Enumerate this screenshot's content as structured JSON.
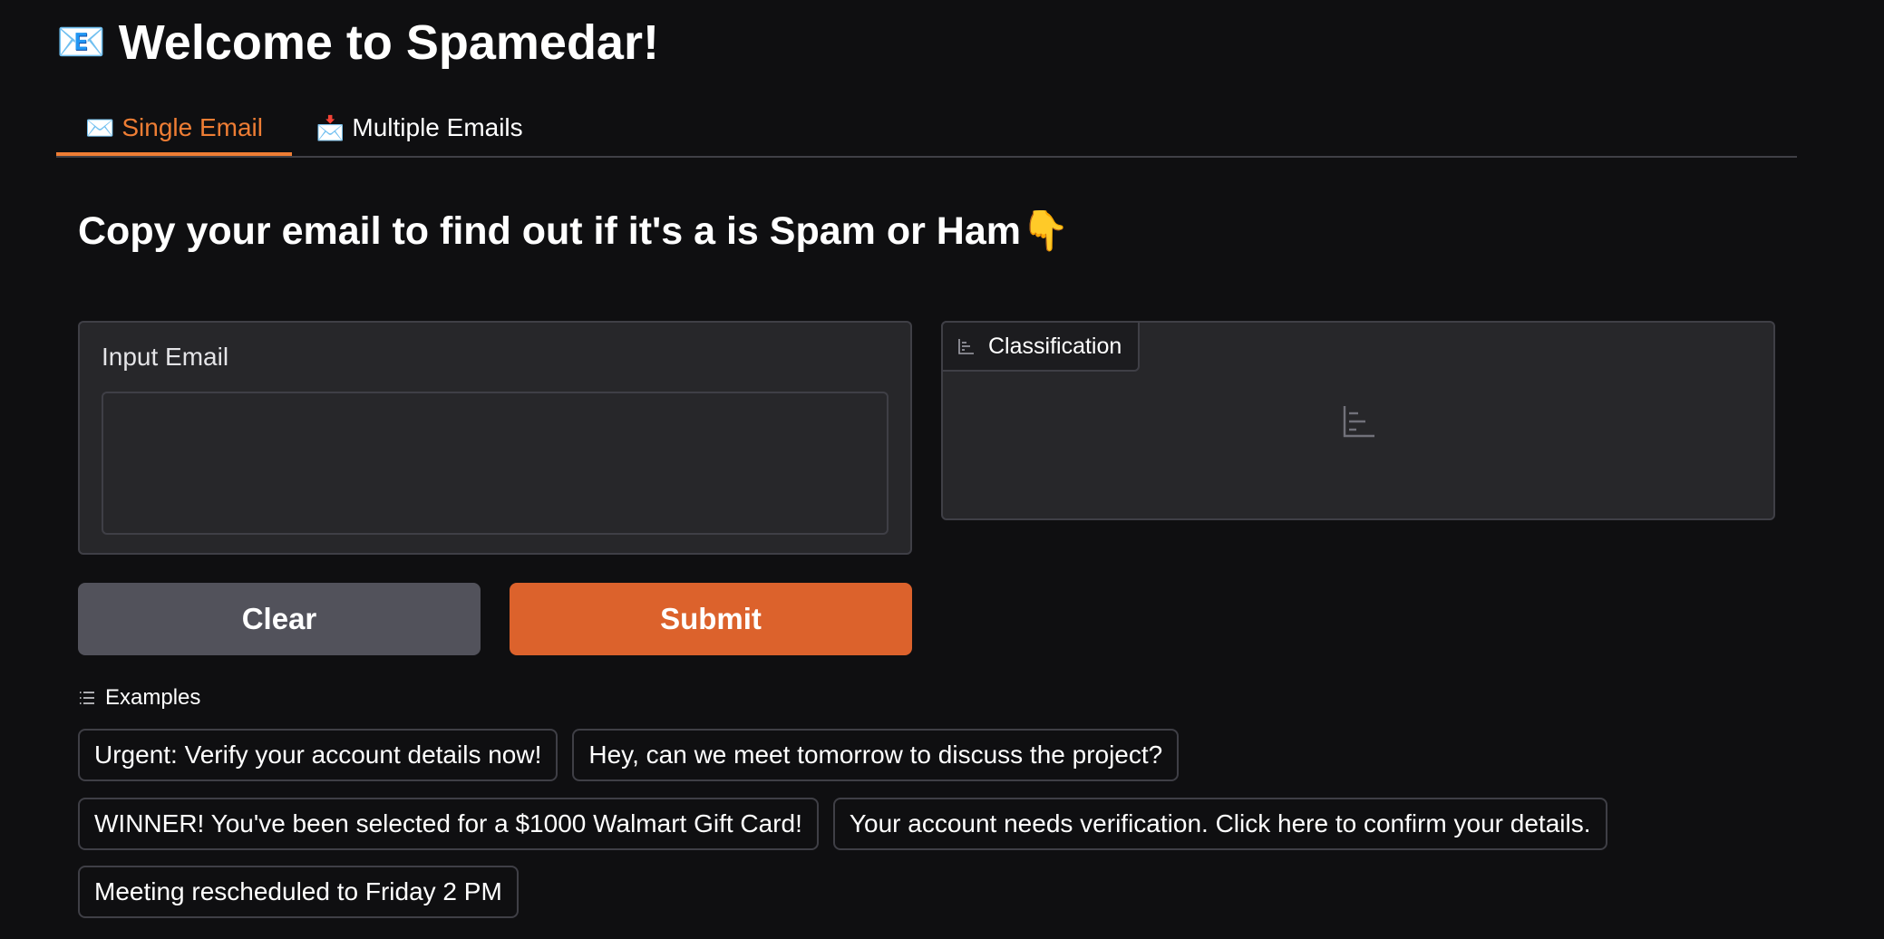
{
  "header": {
    "icon": "📧",
    "icon_name": "envelope-icon",
    "title": "Welcome to Spamedar!"
  },
  "tabs": [
    {
      "icon": "✉️",
      "label": "Single Email",
      "active": true
    },
    {
      "icon": "📩",
      "label": "Multiple Emails",
      "active": false
    }
  ],
  "main": {
    "heading": "Copy your email to find out if it's a is Spam or Ham",
    "heading_emoji": "👇",
    "input": {
      "label": "Input Email",
      "value": "",
      "placeholder": ""
    },
    "output": {
      "label": "Classification",
      "icon_name": "bar-chart-icon"
    },
    "buttons": {
      "clear": "Clear",
      "submit": "Submit"
    },
    "examples": {
      "label": "Examples",
      "icon_name": "list-icon",
      "items": [
        "Urgent: Verify your account details now!",
        "Hey, can we meet tomorrow to discuss the project?",
        "WINNER! You've been selected for a $1000 Walmart Gift Card!",
        "Your account needs verification. Click here to confirm your details.",
        "Meeting rescheduled to Friday 2 PM"
      ]
    }
  },
  "colors": {
    "background": "#0f0f11",
    "panel": "#27272a",
    "border": "#3f3f46",
    "accent": "#ee7d34",
    "submit": "#dc622c",
    "clear": "#52525b"
  }
}
